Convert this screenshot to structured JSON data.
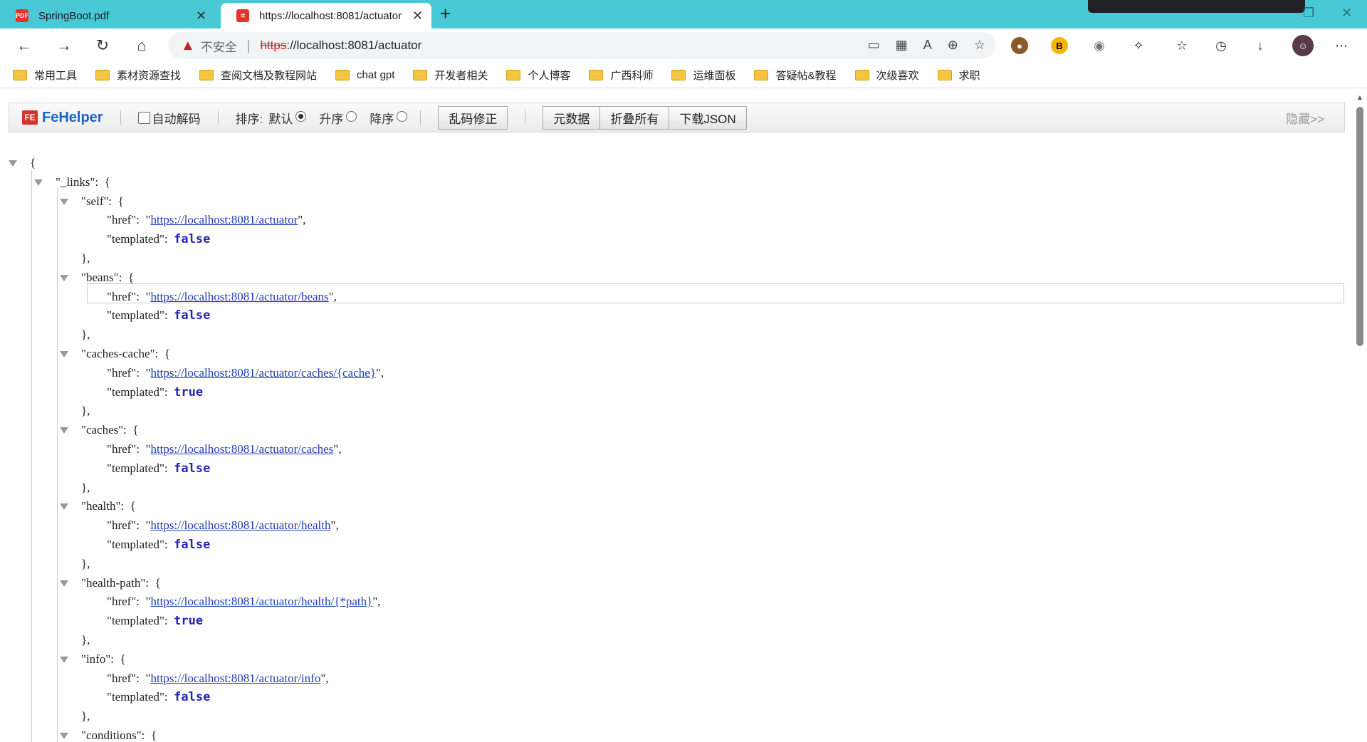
{
  "tabs": [
    {
      "title": "SpringBoot.pdf",
      "favicon": "pdf-icon"
    },
    {
      "title": "https://localhost:8081/actuator",
      "favicon": "spring-icon"
    }
  ],
  "addressbar": {
    "security_label": "不安全",
    "url_scheme": "https",
    "url_rest": "://localhost:8081/actuator"
  },
  "bookmarks": [
    "常用工具",
    "素材资源查找",
    "查阅文档及教程网站",
    "chat gpt",
    "开发者相关",
    "个人博客",
    "广西科师",
    "运维面板",
    "答疑帖&教程",
    "次级喜欢",
    "求职"
  ],
  "fehelper": {
    "logo": "FeHelper",
    "auto_decode": "自动解码",
    "sort_label": "排序:",
    "sort_default": "默认",
    "sort_asc": "升序",
    "sort_desc": "降序",
    "fix_garbled": "乱码修正",
    "metadata": "元数据",
    "collapse_all": "折叠所有",
    "download_json": "下载JSON",
    "hide": "隐藏>>"
  },
  "json": {
    "open_brace": "{",
    "links_key": "\"_links\":",
    "entries": [
      {
        "key": "\"self\":",
        "href": "https://localhost:8081/actuator",
        "templated": "false"
      },
      {
        "key": "\"beans\":",
        "href": "https://localhost:8081/actuator/beans",
        "templated": "false"
      },
      {
        "key": "\"caches-cache\":",
        "href": "https://localhost:8081/actuator/caches/{cache}",
        "templated": "true"
      },
      {
        "key": "\"caches\":",
        "href": "https://localhost:8081/actuator/caches",
        "templated": "false"
      },
      {
        "key": "\"health\":",
        "href": "https://localhost:8081/actuator/health",
        "templated": "false"
      },
      {
        "key": "\"health-path\":",
        "href": "https://localhost:8081/actuator/health/{*path}",
        "templated": "true"
      },
      {
        "key": "\"info\":",
        "href": "https://localhost:8081/actuator/info",
        "templated": "false"
      }
    ],
    "last_key": "\"conditions\":",
    "href_key": "\"href\":",
    "templated_key": "\"templated\":"
  }
}
